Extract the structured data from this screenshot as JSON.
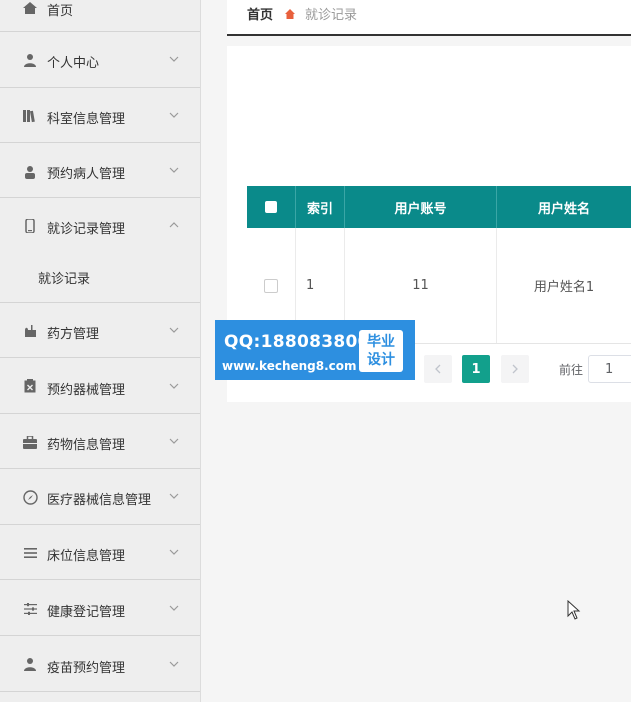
{
  "sidebar": {
    "items": [
      {
        "label": "首页",
        "icon": "home-icon",
        "chevron": false
      },
      {
        "label": "个人中心",
        "icon": "user-icon",
        "chevron": "down"
      },
      {
        "label": "科室信息管理",
        "icon": "books-icon",
        "chevron": "down"
      },
      {
        "label": "预约病人管理",
        "icon": "person-icon",
        "chevron": "down"
      },
      {
        "label": "就诊记录管理",
        "icon": "phone-icon",
        "chevron": "up"
      },
      {
        "label": "药方管理",
        "icon": "mailbox-icon",
        "chevron": "down"
      },
      {
        "label": "预约器械管理",
        "icon": "clipboard-x-icon",
        "chevron": "down"
      },
      {
        "label": "药物信息管理",
        "icon": "briefcase-icon",
        "chevron": "down"
      },
      {
        "label": "医疗器械信息管理",
        "icon": "compass-icon",
        "chevron": "down"
      },
      {
        "label": "床位信息管理",
        "icon": "list-icon",
        "chevron": "down"
      },
      {
        "label": "健康登记管理",
        "icon": "sliders-icon",
        "chevron": "down"
      },
      {
        "label": "疫苗预约管理",
        "icon": "user-icon",
        "chevron": "down"
      }
    ],
    "submenu": {
      "label": "就诊记录"
    }
  },
  "breadcrumb": {
    "home": "首页",
    "current": "就诊记录"
  },
  "table": {
    "columns": [
      "索引",
      "用户账号",
      "用户姓名"
    ],
    "rows": [
      {
        "index": "1",
        "account": "11",
        "name": "用户姓名1"
      }
    ]
  },
  "pagination": {
    "current": "1",
    "goto_label": "前往",
    "goto_value": "1"
  },
  "watermark": {
    "qq": "QQ:188083800",
    "url": "www.kecheng8.com",
    "badge_line1": "毕业",
    "badge_line2": "设计"
  },
  "colors": {
    "header_teal": "#0a8a8a",
    "page_active": "#12a08c",
    "watermark_blue": "#2d8fe0"
  }
}
